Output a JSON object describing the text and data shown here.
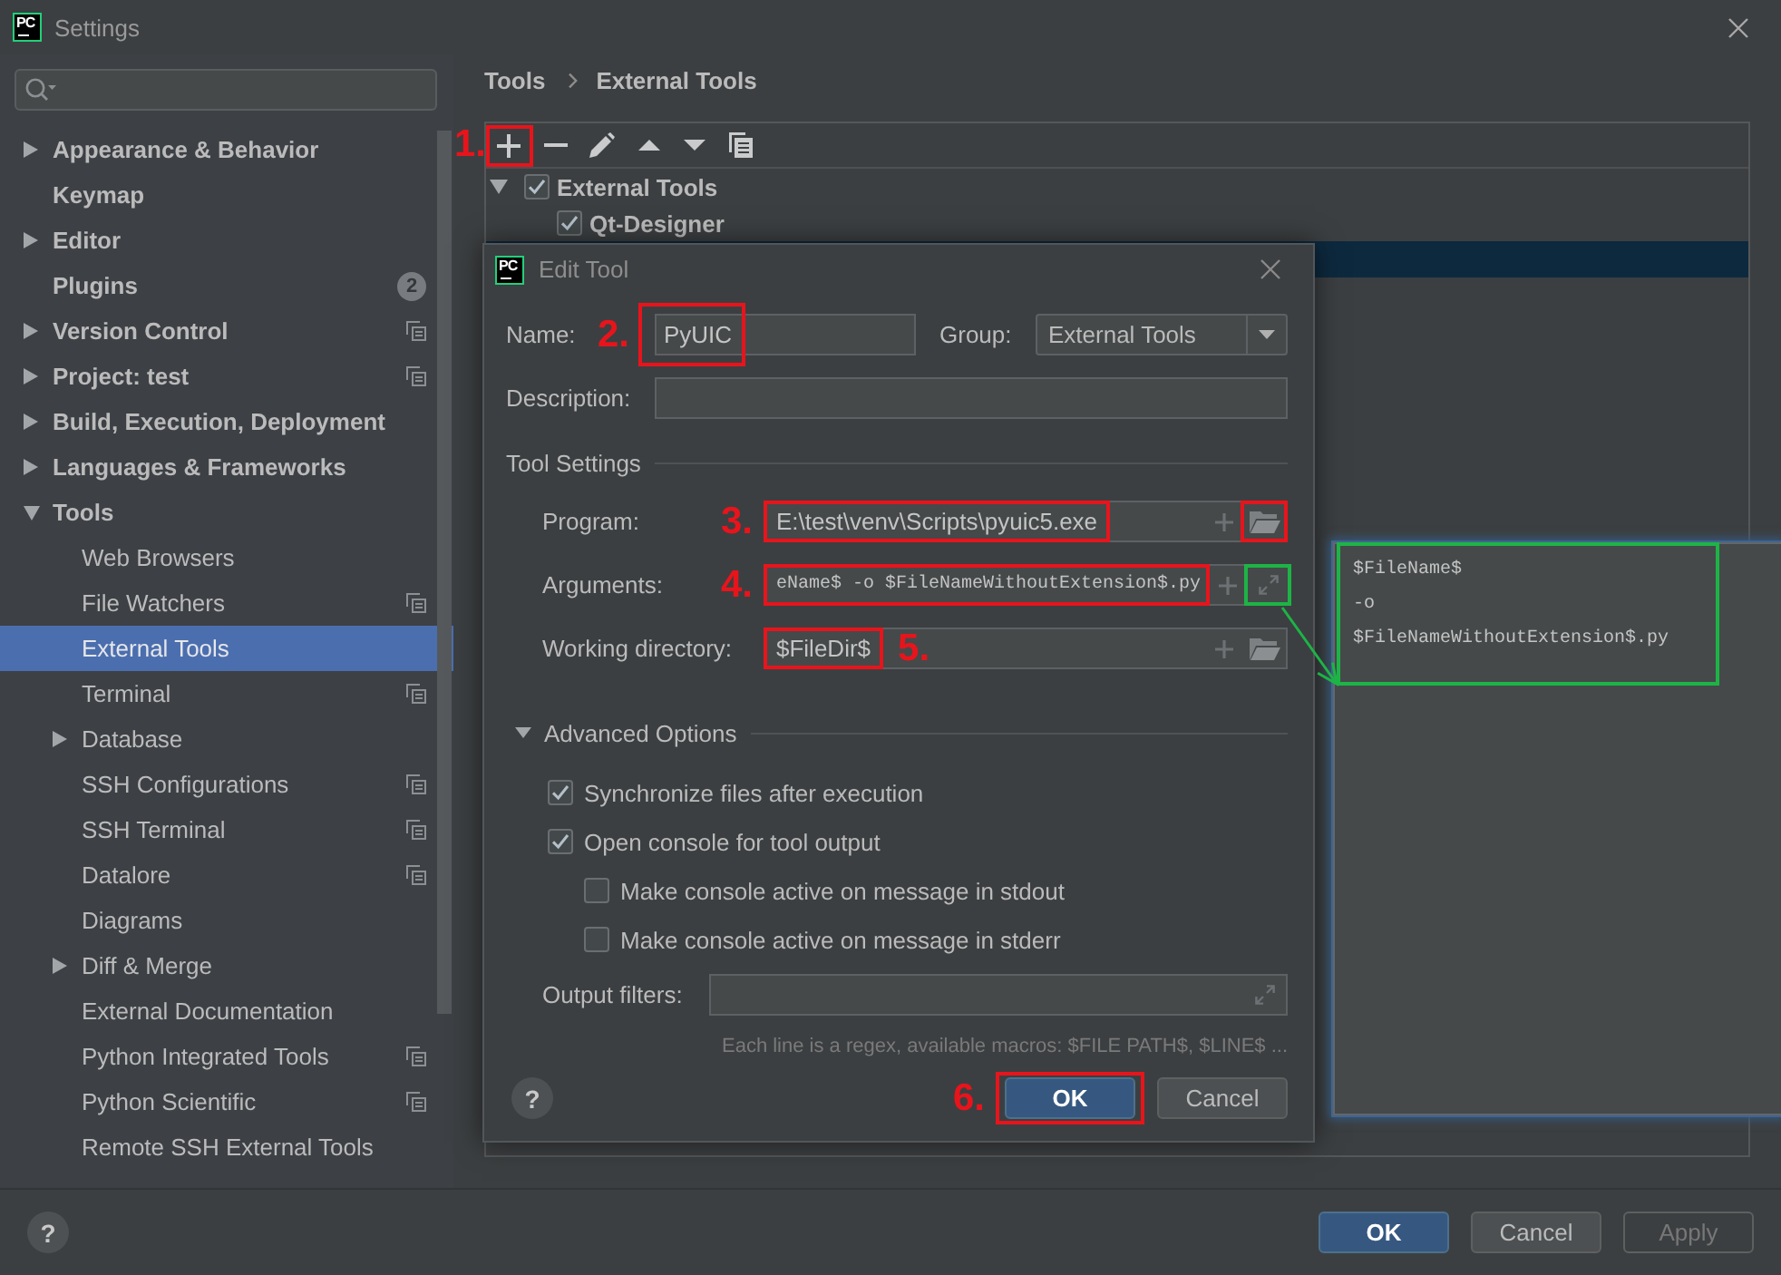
{
  "window": {
    "logo": "PC",
    "title": "Settings"
  },
  "sidebar": {
    "items": [
      {
        "label": "Appearance & Behavior",
        "expanded": false,
        "selected": false,
        "project_level": false
      },
      {
        "label": "Keymap",
        "selected": false,
        "project_level": false
      },
      {
        "label": "Editor",
        "expanded": false,
        "selected": false,
        "project_level": false
      },
      {
        "label": "Plugins",
        "selected": false,
        "project_level": false,
        "badge": "2"
      },
      {
        "label": "Version Control",
        "expanded": false,
        "selected": false,
        "project_level": true
      },
      {
        "label": "Project: test",
        "expanded": false,
        "selected": false,
        "project_level": true
      },
      {
        "label": "Build, Execution, Deployment",
        "expanded": false,
        "selected": false,
        "project_level": false
      },
      {
        "label": "Languages & Frameworks",
        "expanded": false,
        "selected": false,
        "project_level": false
      },
      {
        "label": "Tools",
        "expanded": true,
        "selected": false,
        "project_level": false,
        "children": [
          {
            "label": "Web Browsers",
            "selected": false,
            "project_level": false
          },
          {
            "label": "File Watchers",
            "selected": false,
            "project_level": true
          },
          {
            "label": "External Tools",
            "selected": true,
            "project_level": false
          },
          {
            "label": "Terminal",
            "selected": false,
            "project_level": true
          },
          {
            "label": "Database",
            "expanded": false,
            "selected": false,
            "project_level": false
          },
          {
            "label": "SSH Configurations",
            "selected": false,
            "project_level": true
          },
          {
            "label": "SSH Terminal",
            "selected": false,
            "project_level": true
          },
          {
            "label": "Datalore",
            "selected": false,
            "project_level": true
          },
          {
            "label": "Diagrams",
            "selected": false,
            "project_level": false
          },
          {
            "label": "Diff & Merge",
            "expanded": false,
            "selected": false,
            "project_level": false
          },
          {
            "label": "External Documentation",
            "selected": false,
            "project_level": false
          },
          {
            "label": "Python Integrated Tools",
            "selected": false,
            "project_level": true
          },
          {
            "label": "Python Scientific",
            "selected": false,
            "project_level": true
          },
          {
            "label": "Remote SSH External Tools",
            "selected": false,
            "project_level": false
          }
        ]
      }
    ]
  },
  "breadcrumb": [
    "Tools",
    "External Tools"
  ],
  "toolbar": [
    {
      "kind": "add",
      "frame": {
        "color": "#e8141c"
      },
      "step": "1."
    },
    {
      "kind": "remove"
    },
    {
      "kind": "edit"
    },
    {
      "kind": "move_up"
    },
    {
      "kind": "move_down"
    },
    {
      "kind": "copy"
    }
  ],
  "tool_list": [
    {
      "label": "External Tools",
      "expanded": true,
      "checked": true,
      "selected": false,
      "children": [
        {
          "label": "Qt-Designer",
          "checked": true,
          "selected": false
        },
        {
          "selected": true
        }
      ]
    }
  ],
  "dialog": {
    "logo": "PC",
    "title": "Edit Tool",
    "name": {
      "label": "Name:",
      "step": "2.",
      "value": "PyUIC",
      "frame": {
        "color": "#e8141c"
      }
    },
    "group": {
      "label": "Group:",
      "value": "External Tools"
    },
    "description": {
      "label": "Description:"
    },
    "tool_settings": {
      "title": "Tool Settings",
      "fields": [
        {
          "kind": "program",
          "label": "Program:",
          "step": "3.",
          "value": "E:\\test\\venv\\Scripts\\pyuic5.exe",
          "frame": {
            "color": "#e8141c"
          },
          "buttons": [
            {
              "kind": "add"
            },
            {
              "kind": "browse",
              "frame": {
                "color": "#e8141c"
              }
            }
          ]
        },
        {
          "kind": "arguments",
          "label": "Arguments:",
          "step": "4.",
          "value": "eName$ -o $FileNameWithoutExtension$.py",
          "frame": {
            "color": "#e8141c"
          },
          "buttons": [
            {
              "kind": "add"
            },
            {
              "kind": "expand",
              "frame": {
                "color": "#1db446"
              }
            }
          ]
        },
        {
          "kind": "directory",
          "label": "Working directory:",
          "value": "$FileDir$",
          "trailing_step": "5.",
          "frame": {
            "color": "#e8141c"
          },
          "buttons": [
            {
              "kind": "add"
            },
            {
              "kind": "browse"
            }
          ]
        }
      ]
    },
    "advanced": {
      "title": "Advanced Options",
      "expanded": true,
      "options": [
        {
          "label": "Synchronize files after execution",
          "checked": true
        },
        {
          "label": "Open console for tool output",
          "checked": true,
          "children": [
            {
              "label": "Make console active on message in stdout",
              "checked": false
            },
            {
              "label": "Make console active on message in stderr",
              "checked": false
            }
          ]
        }
      ]
    },
    "output_filters": {
      "label": "Output filters:",
      "hint": "Each line is a regex, available macros: $FILE PATH$, $LINE$ ..."
    },
    "help": "?",
    "buttons": [
      {
        "label": "OK",
        "kind": "primary",
        "step": "6.",
        "frame": {
          "color": "#e8141c"
        }
      },
      {
        "label": "Cancel",
        "kind": "secondary"
      }
    ]
  },
  "popup": {
    "lines": [
      "$FileName$",
      "-o",
      "$FileNameWithoutExtension$.py"
    ],
    "frame": {
      "color": "#1db446"
    },
    "pointer": {
      "color": "#1db446"
    }
  },
  "footer": {
    "help": "?",
    "buttons": [
      {
        "label": "OK",
        "kind": "primary",
        "disabled": false
      },
      {
        "label": "Cancel",
        "kind": "secondary",
        "disabled": false
      },
      {
        "label": "Apply",
        "kind": "secondary",
        "disabled": true
      }
    ]
  }
}
